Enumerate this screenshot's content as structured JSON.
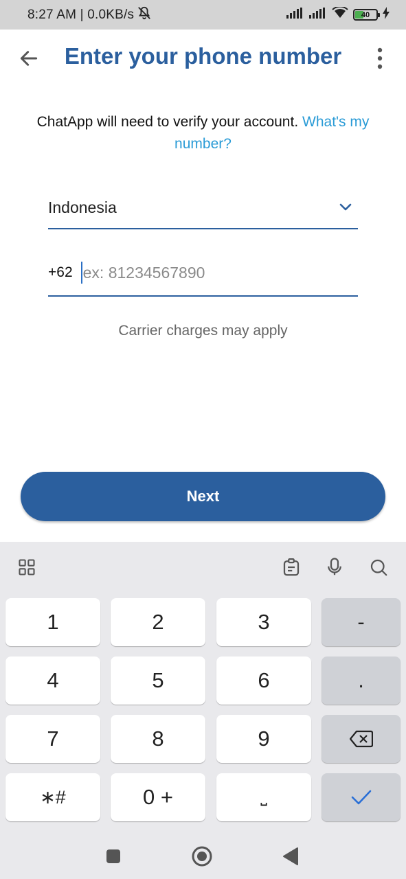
{
  "status_bar": {
    "time_info": "8:27 AM | 0.0KB/s",
    "battery": "40"
  },
  "app_bar": {
    "title": "Enter your phone number"
  },
  "intro": {
    "text": "ChatApp will need to verify your account.",
    "link": "What's my number?"
  },
  "country": {
    "selected": "Indonesia"
  },
  "phone": {
    "country_code": "+62",
    "value": "",
    "placeholder": "ex: 81234567890"
  },
  "carrier_note": "Carrier charges may apply",
  "next_button": "Next",
  "keyboard": {
    "rows": [
      [
        "1",
        "2",
        "3",
        "-"
      ],
      [
        "4",
        "5",
        "6",
        "."
      ],
      [
        "7",
        "8",
        "9",
        ""
      ],
      [
        "∗#",
        "0 +",
        "⎵",
        ""
      ]
    ]
  },
  "colors": {
    "primary": "#2b5f9e",
    "link": "#2a9bd6",
    "keyboard_bg": "#e9e9ec"
  }
}
